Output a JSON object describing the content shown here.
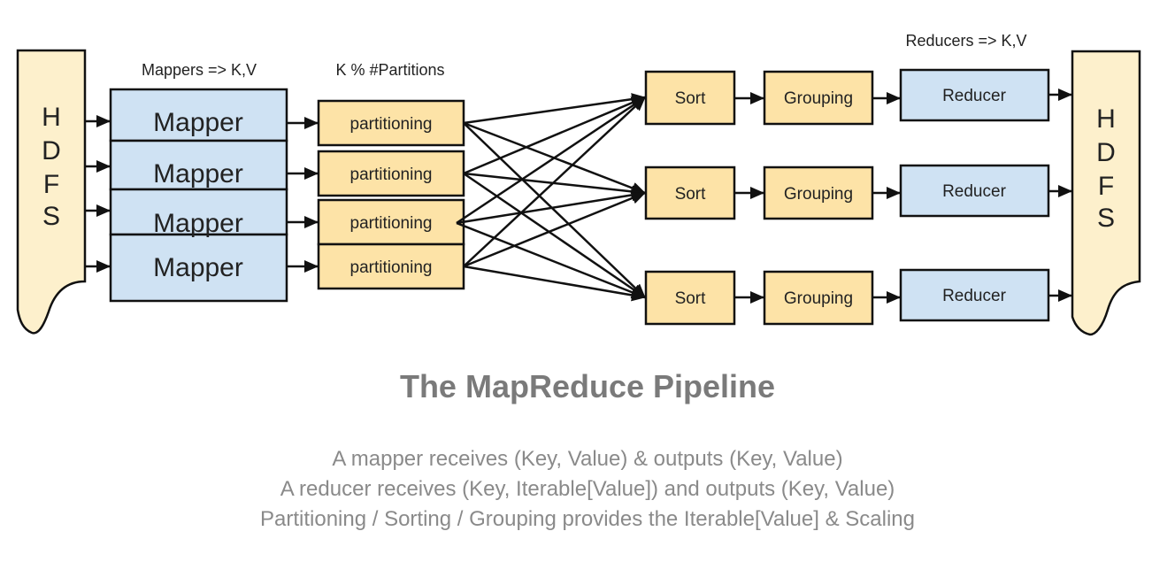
{
  "labels": {
    "mappers_header": "Mappers => K,V",
    "partitions_header": "K % #Partitions",
    "reducers_header": "Reducers => K,V"
  },
  "hdfs_input": {
    "label": "HDFS",
    "letters": [
      "H",
      "D",
      "F",
      "S"
    ]
  },
  "hdfs_output": {
    "label": "HDFS",
    "letters": [
      "H",
      "D",
      "F",
      "S"
    ]
  },
  "mappers": [
    "Mapper",
    "Mapper",
    "Mapper",
    "Mapper"
  ],
  "partitioners": [
    "partitioning",
    "partitioning",
    "partitioning",
    "partitioning"
  ],
  "reduce_lanes": [
    {
      "sort": "Sort",
      "grouping": "Grouping",
      "reducer": "Reducer"
    },
    {
      "sort": "Sort",
      "grouping": "Grouping",
      "reducer": "Reducer"
    },
    {
      "sort": "Sort",
      "grouping": "Grouping",
      "reducer": "Reducer"
    }
  ],
  "colors": {
    "hdfs_fill": "#fdf0cc",
    "mapper_fill": "#cfe2f3",
    "partition_fill": "#fde3a7",
    "sort_fill": "#fde3a7",
    "reducer_fill": "#cfe2f3",
    "stroke": "#111111",
    "caption": "#7a7a7a"
  },
  "caption": {
    "title": "The MapReduce Pipeline",
    "lines": [
      "A mapper receives (Key, Value) & outputs (Key, Value)",
      "A reducer receives (Key, Iterable[Value]) and outputs (Key, Value)",
      "Partitioning / Sorting / Grouping provides the Iterable[Value] & Scaling"
    ]
  }
}
